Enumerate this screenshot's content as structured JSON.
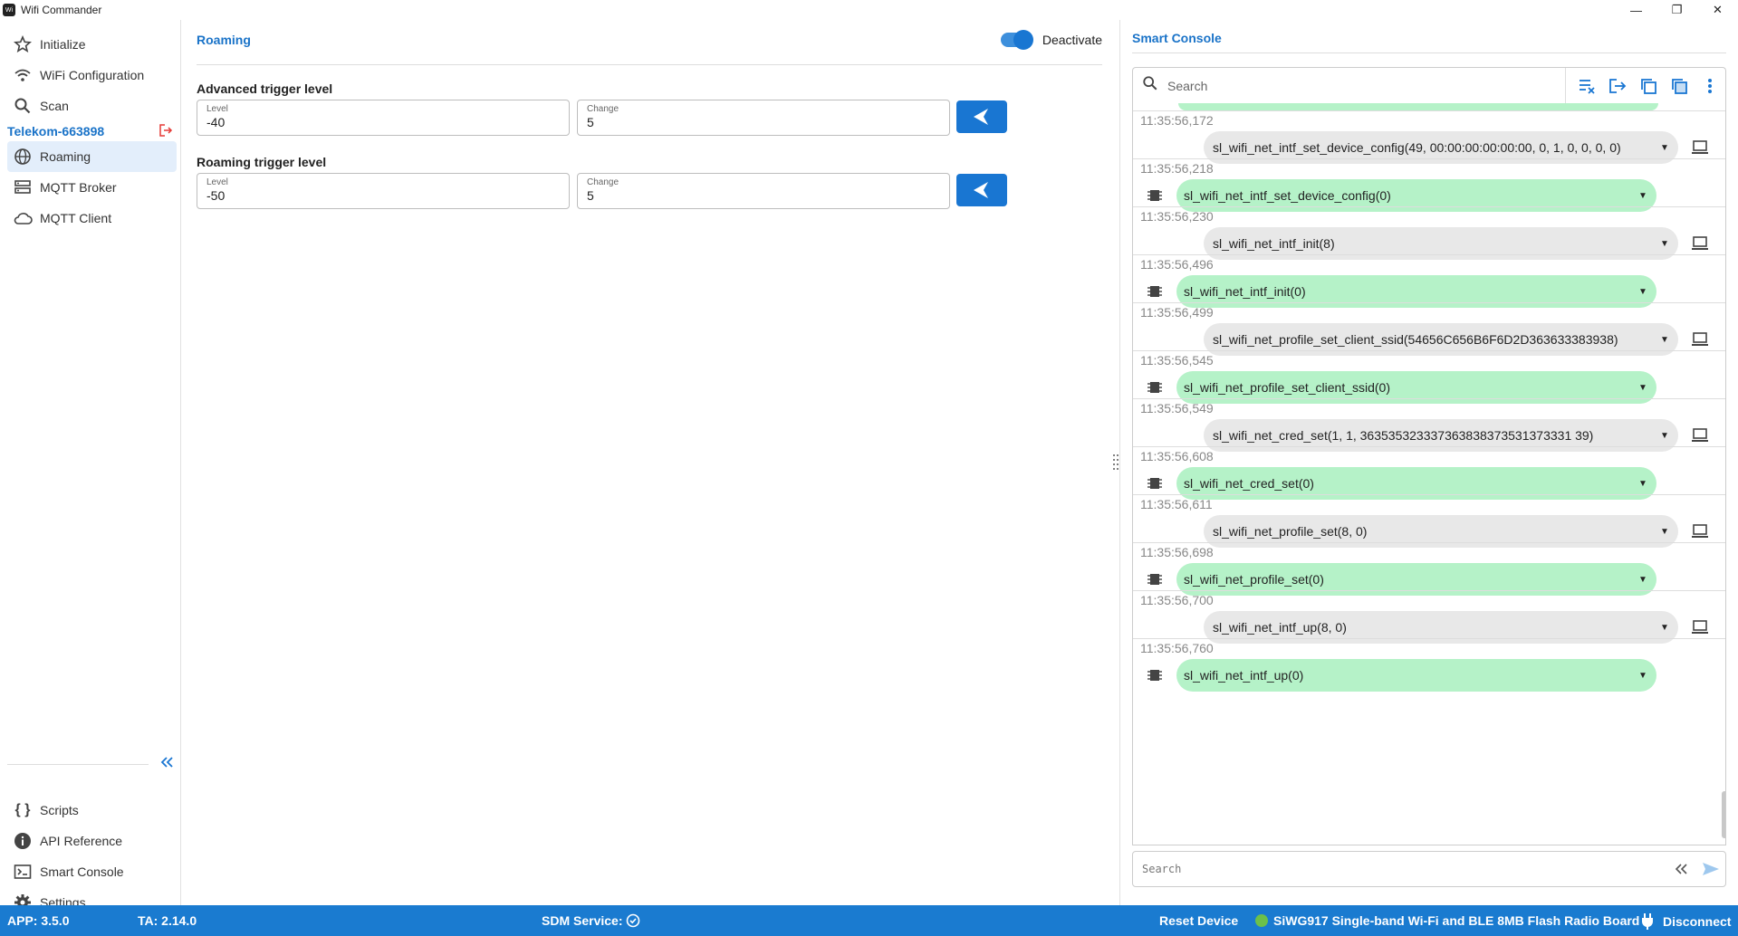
{
  "window": {
    "title": "Wifi Commander",
    "app_icon_text": "Wi"
  },
  "sidebar": {
    "top_items": [
      {
        "label": "Initialize",
        "icon": "star-icon"
      },
      {
        "label": "WiFi Configuration",
        "icon": "wifi-icon"
      },
      {
        "label": "Scan",
        "icon": "search-icon"
      }
    ],
    "device_name": "Telekom-663898",
    "device_items": [
      {
        "label": "Roaming",
        "icon": "globe-icon",
        "active": true
      },
      {
        "label": "MQTT Broker",
        "icon": "server-icon"
      },
      {
        "label": "MQTT Client",
        "icon": "cloud-icon"
      }
    ],
    "bottom_items": [
      {
        "label": "Scripts",
        "icon": "braces-icon"
      },
      {
        "label": "API Reference",
        "icon": "info-icon"
      },
      {
        "label": "Smart Console",
        "icon": "terminal-icon"
      },
      {
        "label": "Settings",
        "icon": "gear-icon"
      }
    ]
  },
  "main": {
    "title": "Roaming",
    "toggle_label": "Deactivate",
    "toggle_on": true,
    "advanced": {
      "label": "Advanced trigger level",
      "level_label": "Level",
      "level_value": "-40",
      "change_label": "Change",
      "change_value": "5"
    },
    "roaming": {
      "label": "Roaming trigger level",
      "level_label": "Level",
      "level_value": "-50",
      "change_label": "Change",
      "change_value": "5"
    }
  },
  "console": {
    "title": "Smart Console",
    "search_placeholder": "Search",
    "command_placeholder": "Search",
    "entries": [
      {
        "time": "11:35:56,172",
        "dir": "tx",
        "text": "sl_wifi_net_intf_set_device_config(49, 00:00:00:00:00:00, 0, 1, 0, 0, 0, 0)"
      },
      {
        "time": "11:35:56,218",
        "dir": "rx",
        "text": "sl_wifi_net_intf_set_device_config(0)"
      },
      {
        "time": "11:35:56,230",
        "dir": "tx",
        "text": "sl_wifi_net_intf_init(8)"
      },
      {
        "time": "11:35:56,496",
        "dir": "rx",
        "text": "sl_wifi_net_intf_init(0)"
      },
      {
        "time": "11:35:56,499",
        "dir": "tx",
        "text": "sl_wifi_net_profile_set_client_ssid(54656C656B6F6D2D363633383938)"
      },
      {
        "time": "11:35:56,545",
        "dir": "rx",
        "text": "sl_wifi_net_profile_set_client_ssid(0)"
      },
      {
        "time": "11:35:56,549",
        "dir": "tx",
        "text": "sl_wifi_net_cred_set(1, 1, 363535323337363838373531373331 39)"
      },
      {
        "time": "11:35:56,608",
        "dir": "rx",
        "text": "sl_wifi_net_cred_set(0)"
      },
      {
        "time": "11:35:56,611",
        "dir": "tx",
        "text": "sl_wifi_net_profile_set(8, 0)"
      },
      {
        "time": "11:35:56,698",
        "dir": "rx",
        "text": "sl_wifi_net_profile_set(0)"
      },
      {
        "time": "11:35:56,700",
        "dir": "tx",
        "text": "sl_wifi_net_intf_up(8, 0)"
      },
      {
        "time": "11:35:56,760",
        "dir": "rx",
        "text": "sl_wifi_net_intf_up(0)"
      }
    ]
  },
  "statusbar": {
    "app_version": "APP: 3.5.0",
    "ta_version": "TA: 2.14.0",
    "sdm_service": "SDM Service:",
    "reset_device": "Reset Device",
    "board": "SiWG917 Single-band Wi-Fi and BLE 8MB Flash Radio Board",
    "disconnect": "Disconnect"
  },
  "colors": {
    "accent": "#1976d2",
    "rx_bubble": "#b5f2c8",
    "tx_bubble": "#e8e8e8",
    "statusbar": "#1a7bd0"
  }
}
